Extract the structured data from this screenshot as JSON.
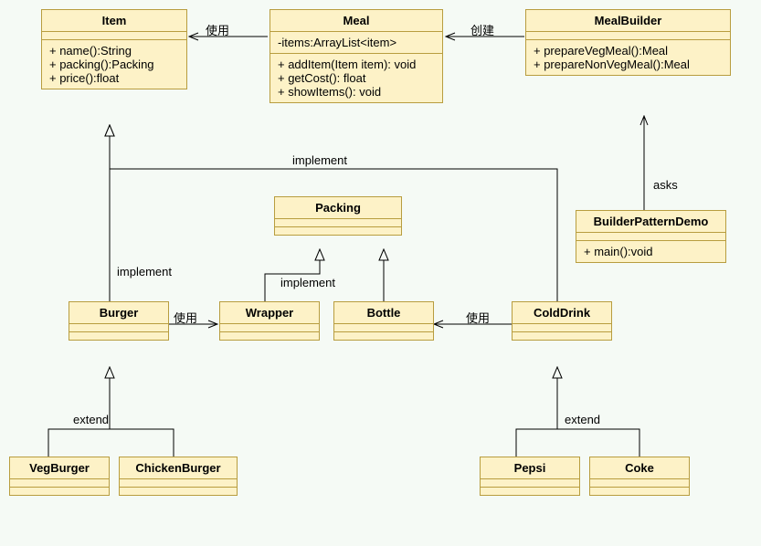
{
  "classes": {
    "item": {
      "name": "Item",
      "methods": [
        "+ name():String",
        "+ packing():Packing",
        "+ price():float"
      ]
    },
    "meal": {
      "name": "Meal",
      "attrs": [
        "-items:ArrayList<item>"
      ],
      "methods": [
        "+ addItem(Item item): void",
        "+ getCost(): float",
        "+ showItems(): void"
      ]
    },
    "mealbuilder": {
      "name": "MealBuilder",
      "methods": [
        "+ prepareVegMeal():Meal",
        "+ prepareNonVegMeal():Meal"
      ]
    },
    "packing": {
      "name": "Packing"
    },
    "builderdemo": {
      "name": "BuilderPatternDemo",
      "methods": [
        "+ main():void"
      ]
    },
    "burger": {
      "name": "Burger"
    },
    "wrapper": {
      "name": "Wrapper"
    },
    "bottle": {
      "name": "Bottle"
    },
    "colddrink": {
      "name": "ColdDrink"
    },
    "vegburger": {
      "name": "VegBurger"
    },
    "chickenburger": {
      "name": "ChickenBurger"
    },
    "pepsi": {
      "name": "Pepsi"
    },
    "coke": {
      "name": "Coke"
    }
  },
  "labels": {
    "use1": "使用",
    "create": "创建",
    "implement": "implement",
    "asks": "asks",
    "use2": "使用",
    "use3": "使用",
    "extend": "extend"
  }
}
